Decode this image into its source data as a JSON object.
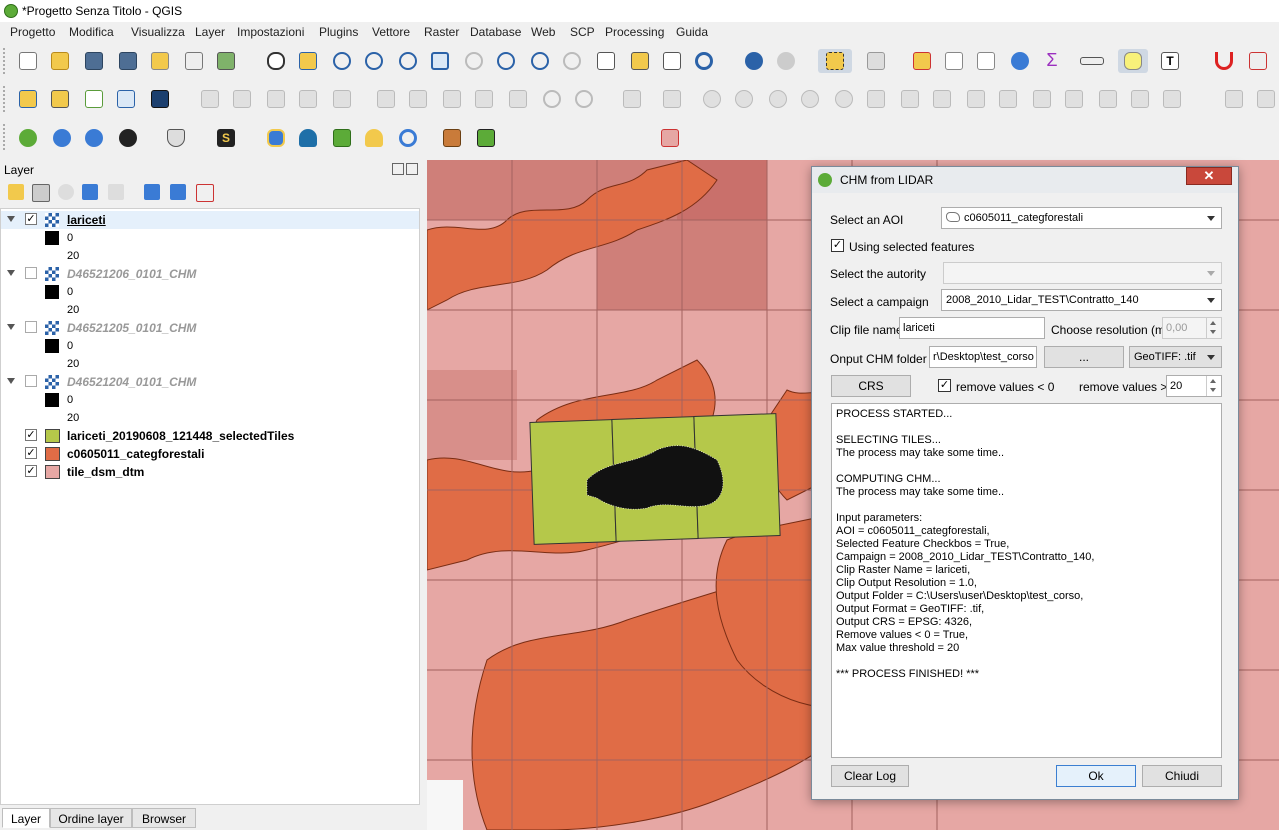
{
  "window": {
    "title": "*Progetto Senza Titolo - QGIS"
  },
  "menu": [
    "Progetto",
    "Modifica",
    "Visualizza",
    "Layer",
    "Impostazioni",
    "Plugins",
    "Vettore",
    "Raster",
    "Database",
    "Web",
    "SCP",
    "Processing",
    "Guida"
  ],
  "layer_panel": {
    "title": "Layer",
    "layers": [
      {
        "name": "lariceti",
        "visible": true,
        "type": "raster",
        "legend": [
          "0",
          "20"
        ]
      },
      {
        "name": "D46521206_0101_CHM",
        "visible": false,
        "type": "raster",
        "legend": [
          "0",
          "20"
        ]
      },
      {
        "name": "D46521205_0101_CHM",
        "visible": false,
        "type": "raster",
        "legend": [
          "0",
          "20"
        ]
      },
      {
        "name": "D46521204_0101_CHM",
        "visible": false,
        "type": "raster",
        "legend": [
          "0",
          "20"
        ]
      },
      {
        "name": "lariceti_20190608_121448_selectedTiles",
        "visible": true,
        "type": "polygon",
        "color": "#b5c84a"
      },
      {
        "name": "c0605011_categforestali",
        "visible": true,
        "type": "polygon",
        "color": "#e06c46"
      },
      {
        "name": "tile_dsm_dtm",
        "visible": true,
        "type": "polygon",
        "color": "#e6a7a4"
      }
    ],
    "tabs": [
      "Layer",
      "Ordine layer",
      "Browser"
    ]
  },
  "dialog": {
    "title": "CHM from LIDAR",
    "aoi_label": "Select an AOI",
    "aoi_value": "c0605011_categforestali",
    "selected_features_label": "Using selected features",
    "selected_features_checked": true,
    "autority_label": "Select the autority",
    "autority_value": "",
    "campaign_label": "Select a campaign",
    "campaign_value": "2008_2010_Lidar_TEST\\Contratto_140",
    "clip_label": "Clip file name",
    "clip_value": "lariceti",
    "resolution_label": "Choose resolution (m)",
    "resolution_value": "0,00",
    "output_label": "Onput CHM folder",
    "output_value": "r\\Desktop\\test_corso",
    "browse_label": "...",
    "format_value": "GeoTIFF: .tif",
    "crs_label": "CRS",
    "remove_neg_label": "remove values < 0",
    "remove_neg_checked": true,
    "remove_gt_label": "remove values >",
    "remove_gt_value": "20",
    "log_lines": [
      "PROCESS STARTED...",
      "",
      "SELECTING TILES...",
      "The process may take some time..",
      "",
      "COMPUTING CHM...",
      "The process may take some time..",
      "",
      "Input parameters:",
      "AOI = c0605011_categforestali,",
      "Selected Feature Checkbos = True,",
      "Campaign = 2008_2010_Lidar_TEST\\Contratto_140,",
      "Clip Raster Name = lariceti,",
      "Clip Output Resolution = 1.0,",
      "Output Folder = C:\\Users\\user\\Desktop\\test_corso,",
      "Output Format = GeoTIFF: .tif,",
      "Output CRS = EPSG: 4326,",
      "Remove values < 0 = True,",
      "Max value threshold = 20",
      "",
      "*** PROCESS FINISHED! ***"
    ],
    "clear_log_label": "Clear Log",
    "ok_label": "Ok",
    "close_label": "Chiudi"
  },
  "colors": {
    "forest": "#e06c46",
    "tile_grid": "#e6a7a4",
    "tile_dark": "#cf7f79",
    "selected_tiles": "#b5c84a"
  }
}
